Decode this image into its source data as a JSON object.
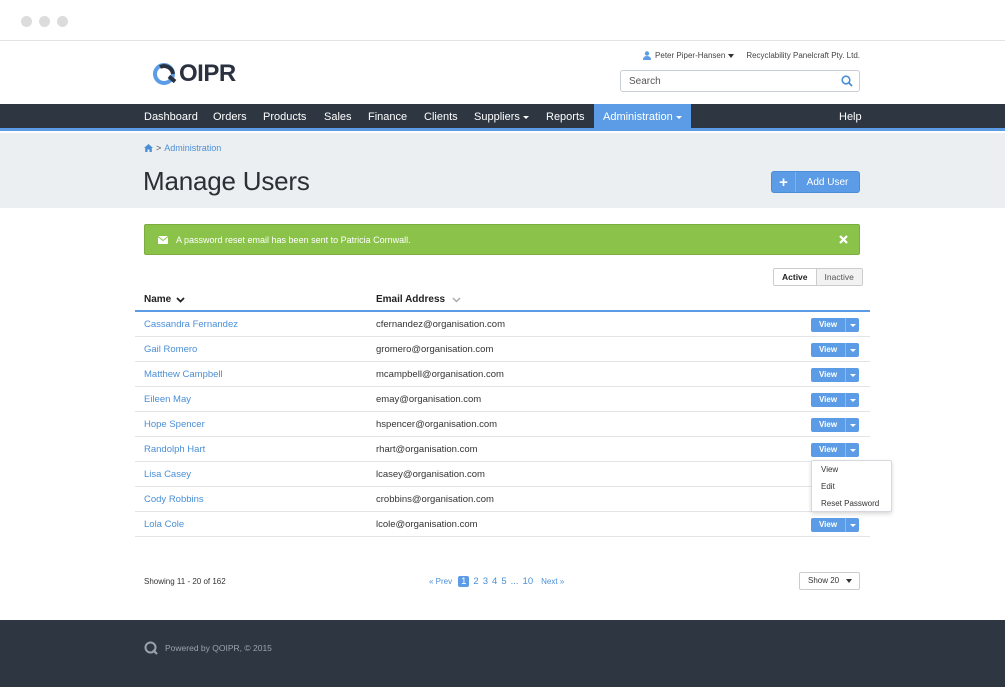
{
  "header": {
    "logo_text": "OIPR",
    "user_name": "Peter Piper-Hansen",
    "company": "Recyclability Panelcraft Pty. Ltd.",
    "search_placeholder": "Search"
  },
  "nav": {
    "items": [
      "Dashboard",
      "Orders",
      "Products",
      "Sales",
      "Finance",
      "Clients",
      "Suppliers",
      "Reports",
      "Administration"
    ],
    "help": "Help",
    "active_index": 8
  },
  "page": {
    "breadcrumb_sep": ">",
    "breadcrumb_link": "Administration",
    "title": "Manage Users",
    "add_button": "Add User"
  },
  "alert": {
    "message": "A password reset email has been sent to Patricia Cornwall."
  },
  "filter": {
    "active": "Active",
    "inactive": "Inactive"
  },
  "table": {
    "col_name": "Name",
    "col_email": "Email Address",
    "view_label": "View",
    "rows": [
      {
        "name": "Cassandra Fernandez",
        "email": "cfernandez@organisation.com"
      },
      {
        "name": "Gail Romero",
        "email": "gromero@organisation.com"
      },
      {
        "name": "Matthew Campbell",
        "email": "mcampbell@organisation.com"
      },
      {
        "name": "Eileen May",
        "email": "emay@organisation.com"
      },
      {
        "name": "Hope Spencer",
        "email": "hspencer@organisation.com"
      },
      {
        "name": "Randolph Hart",
        "email": "rhart@organisation.com"
      },
      {
        "name": "Lisa Casey",
        "email": "lcasey@organisation.com"
      },
      {
        "name": "Cody Robbins",
        "email": "crobbins@organisation.com"
      },
      {
        "name": "Lola Cole",
        "email": "lcole@organisation.com"
      }
    ]
  },
  "row_menu": {
    "items": [
      "View",
      "Edit",
      "Reset Password"
    ]
  },
  "pagination": {
    "showing": "Showing 11 - 20 of 162",
    "prev": "« Prev",
    "pages": [
      "1",
      "2",
      "3",
      "4",
      "5"
    ],
    "ellipsis": "...",
    "last": "10",
    "next": "Next »",
    "current": "1",
    "show_label": "Show 20"
  },
  "footer": {
    "text": "Powered by QOIPR, © 2015"
  },
  "colors": {
    "accent": "#5c9ce6",
    "nav_bg": "#2e3642",
    "success": "#8bc34a"
  }
}
